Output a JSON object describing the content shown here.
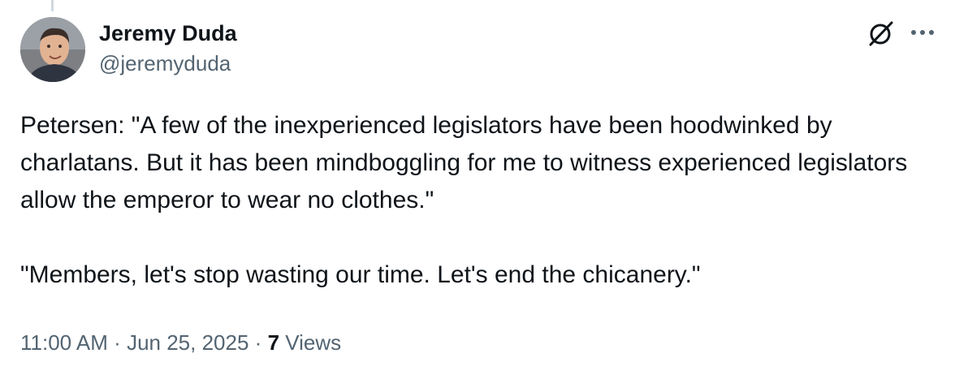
{
  "author": {
    "display_name": "Jeremy Duda",
    "handle": "@jeremyduda"
  },
  "icons": {
    "grok": "grok-slash-icon",
    "more": "more-horizontal-icon"
  },
  "tweet": {
    "paragraphs": [
      "Petersen: \"A few of the inexperienced legislators have been hoodwinked by charlatans. But it has been mindboggling for me to witness experienced legislators allow the emperor to wear no clothes.\"",
      "\"Members, let's stop wasting our time. Let's end the chicanery.\""
    ]
  },
  "meta": {
    "time": "11:00 AM",
    "separator": "·",
    "date": "Jun 25, 2025",
    "views_count": "7",
    "views_label": "Views"
  },
  "colors": {
    "text": "#0f1419",
    "secondary": "#536471",
    "thread_line": "#cfd9de"
  }
}
